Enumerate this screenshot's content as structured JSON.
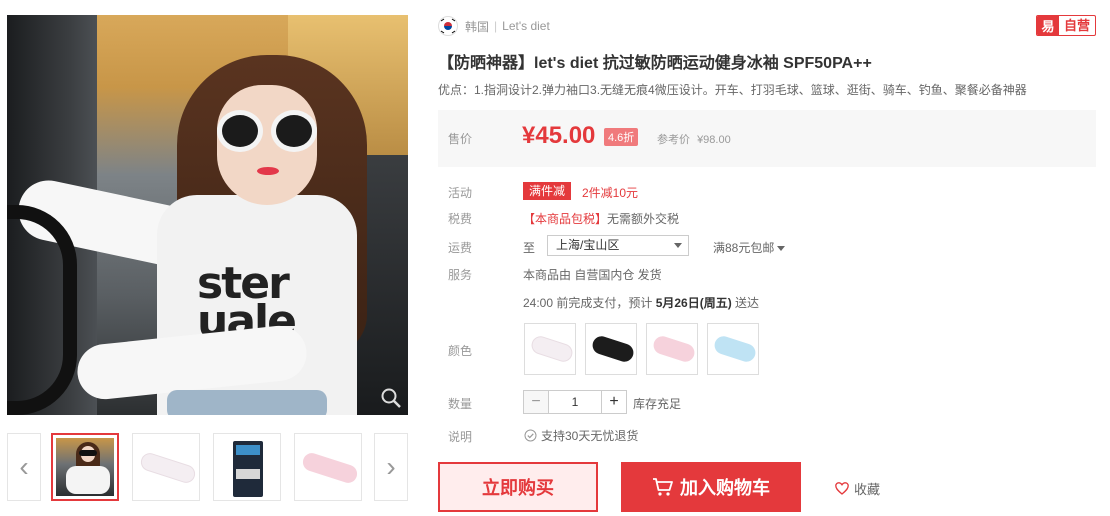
{
  "product": {
    "origin_country": "韩国",
    "brand": "Let's diet",
    "self_badge_icon": "易",
    "self_badge_text": "自营",
    "title": "【防晒神器】let's diet 抗过敏防晒运动健身冰袖 SPF50PA++",
    "subtitle": "优点：1.指洞设计2.弹力袖口3.无缝无痕4微压设计。开车、打羽毛球、篮球、逛街、骑车、钓鱼、聚餐必备神器"
  },
  "price": {
    "label": "售价",
    "value": "¥45.00",
    "discount": "4.6折",
    "ref_label": "参考价",
    "ref_value": "¥98.00"
  },
  "promotion": {
    "label": "活动",
    "tag": "满件减",
    "text": "2件减10元"
  },
  "tax": {
    "label": "税费",
    "highlight": "【本商品包税】",
    "text": "无需额外交税"
  },
  "shipping": {
    "label": "运费",
    "to": "至",
    "address": "上海/宝山区",
    "free_text": "满88元包邮"
  },
  "service": {
    "label": "服务",
    "text": "本商品由 自营国内仓 发货"
  },
  "delivery": {
    "prefix": "24:00 前完成支付，预计 ",
    "date": "5月26日(周五)",
    "suffix": " 送达"
  },
  "colors": {
    "label": "颜色",
    "options": [
      {
        "name": "白色",
        "color": "#f4eef2"
      },
      {
        "name": "黑色",
        "color": "#1c1c1c"
      },
      {
        "name": "粉色",
        "color": "#f6d2dc"
      },
      {
        "name": "蓝色",
        "color": "#bfe3f4"
      }
    ]
  },
  "quantity": {
    "label": "数量",
    "value": "1",
    "minus": "−",
    "plus": "+",
    "stock": "库存充足"
  },
  "note": {
    "label": "说明",
    "text": "支持30天无忧退货"
  },
  "actions": {
    "buy_now": "立即购买",
    "add_cart": "加入购物车",
    "favorite": "收藏"
  },
  "gallery": {
    "prev": "‹",
    "next": "›"
  },
  "image_text": {
    "shirt": "ster\nuale"
  },
  "accent_color": "#e4393c"
}
